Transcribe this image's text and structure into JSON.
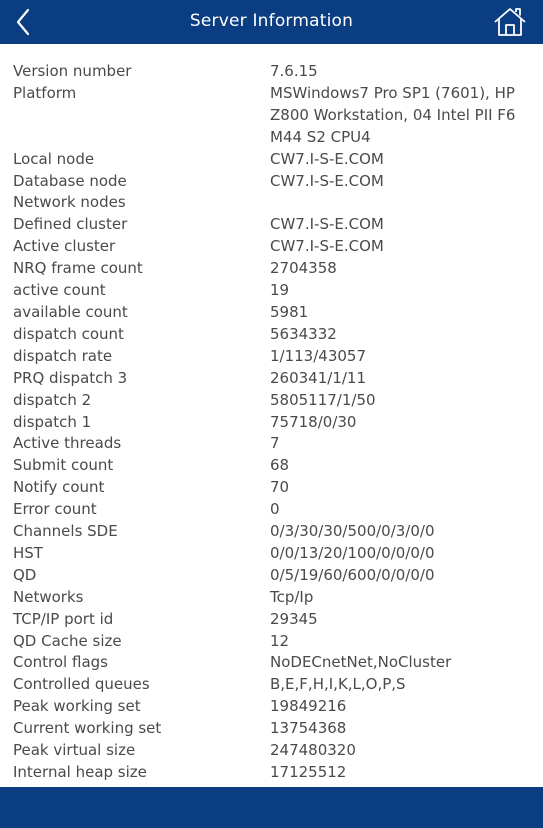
{
  "header": {
    "title": "Server Information",
    "back_icon": "chevron-left-icon",
    "home_icon": "home-icon"
  },
  "colors": {
    "bar": "#0b3d82",
    "text": "#4a4a4a",
    "background": "#ffffff"
  },
  "rows": [
    {
      "label": "Version number",
      "value": "7.6.15"
    },
    {
      "label": "Platform",
      "value": "MSWindows7 Pro SP1 (7601), HP Z800 Workstation, 04 Intel PII F6 M44 S2 CPU4"
    },
    {
      "label": "Local node",
      "value": "CW7.I-S-E.COM"
    },
    {
      "label": "Database node",
      "value": "CW7.I-S-E.COM"
    },
    {
      "label": "Network nodes",
      "value": ""
    },
    {
      "label": "Defined cluster",
      "value": "CW7.I-S-E.COM"
    },
    {
      "label": "Active cluster",
      "value": "CW7.I-S-E.COM"
    },
    {
      "label": "NRQ frame count",
      "value": "2704358"
    },
    {
      "label": "active count",
      "value": "19"
    },
    {
      "label": "available count",
      "value": "5981"
    },
    {
      "label": "dispatch count",
      "value": "5634332"
    },
    {
      "label": "dispatch rate",
      "value": "1/113/43057"
    },
    {
      "label": "PRQ dispatch 3",
      "value": "260341/1/11"
    },
    {
      "label": "dispatch 2",
      "value": "5805117/1/50"
    },
    {
      "label": "dispatch 1",
      "value": "75718/0/30"
    },
    {
      "label": "Active threads",
      "value": "7"
    },
    {
      "label": "Submit count",
      "value": "68"
    },
    {
      "label": "Notify count",
      "value": "70"
    },
    {
      "label": "Error count",
      "value": "0"
    },
    {
      "label": "Channels SDE",
      "value": "0/3/30/30/500/0/3/0/0"
    },
    {
      "label": "HST",
      "value": "0/0/13/20/100/0/0/0/0"
    },
    {
      "label": "QD",
      "value": "0/5/19/60/600/0/0/0/0"
    },
    {
      "label": "Networks",
      "value": "Tcp/Ip"
    },
    {
      "label": "TCP/IP port id",
      "value": "29345"
    },
    {
      "label": "QD Cache size",
      "value": "12"
    },
    {
      "label": "Control flags",
      "value": "NoDECnetNet,NoCluster"
    },
    {
      "label": "Controlled queues",
      "value": "B,E,F,H,I,K,L,O,P,S"
    },
    {
      "label": "Peak working set",
      "value": "19849216"
    },
    {
      "label": "Current working set",
      "value": "13754368"
    },
    {
      "label": "Peak virtual size",
      "value": "247480320"
    },
    {
      "label": "Internal heap size",
      "value": "17125512"
    }
  ]
}
